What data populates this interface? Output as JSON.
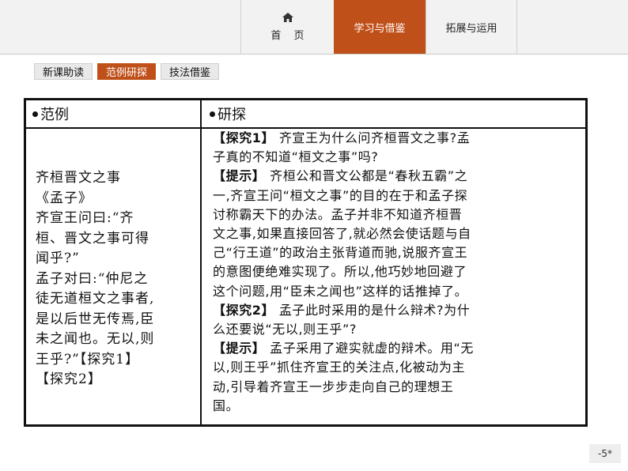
{
  "nav": {
    "home_label": "首 页",
    "study_label": "学习与借鉴",
    "extend_label": "拓展与运用"
  },
  "subtabs": [
    {
      "label": "新课助读"
    },
    {
      "label": "范例研探"
    },
    {
      "label": "技法借鉴"
    }
  ],
  "table": {
    "left_header": "范例",
    "right_header": "研探",
    "left_lines": [
      "齐桓晋文之事",
      "《孟子》",
      "齐宣王问曰:“齐",
      "桓、晋文之事可得",
      "闻乎?”",
      "孟子对曰:“仲尼之",
      "徒无道桓文之事者,",
      "是以后世无传焉,臣",
      "未之闻也。无以,则",
      "王乎?”【探究1】",
      "【探究2】"
    ],
    "right_lines": [
      {
        "tag": "【探究1】",
        "text": " 齐宣王为什么问齐桓晋文之事?孟"
      },
      {
        "tag": "",
        "text": "子真的不知道“桓文之事”吗?"
      },
      {
        "tag": "【提示】",
        "text": " 齐桓公和晋文公都是“春秋五霸”之"
      },
      {
        "tag": "",
        "text": "一,齐宣王问“桓文之事”的目的在于和孟子探"
      },
      {
        "tag": "",
        "text": "讨称霸天下的办法。孟子并非不知道齐桓晋"
      },
      {
        "tag": "",
        "text": "文之事,如果直接回答了,就必然会使话题与自"
      },
      {
        "tag": "",
        "text": "己“行王道”的政治主张背道而驰,说服齐宣王"
      },
      {
        "tag": "",
        "text": "的意图便绝难实现了。所以,他巧妙地回避了"
      },
      {
        "tag": "",
        "text": "这个问题,用“臣未之闻也”这样的话推掉了。"
      },
      {
        "tag": "【探究2】",
        "text": " 孟子此时采用的是什么辩术?为什"
      },
      {
        "tag": "",
        "text": "么还要说“无以,则王乎”?"
      },
      {
        "tag": "【提示】",
        "text": " 孟子采用了避实就虚的辩术。用“无"
      },
      {
        "tag": "",
        "text": "以,则王乎”抓住齐宣王的关注点,化被动为主"
      },
      {
        "tag": "",
        "text": "动,引导着齐宣王一步步走向自己的理想王"
      },
      {
        "tag": "",
        "text": "国。"
      }
    ]
  },
  "page_number": "-5*",
  "colors": {
    "accent": "#c0501a",
    "nav_bg": "#f2f2f2"
  },
  "icons": {
    "home": "home-icon"
  }
}
